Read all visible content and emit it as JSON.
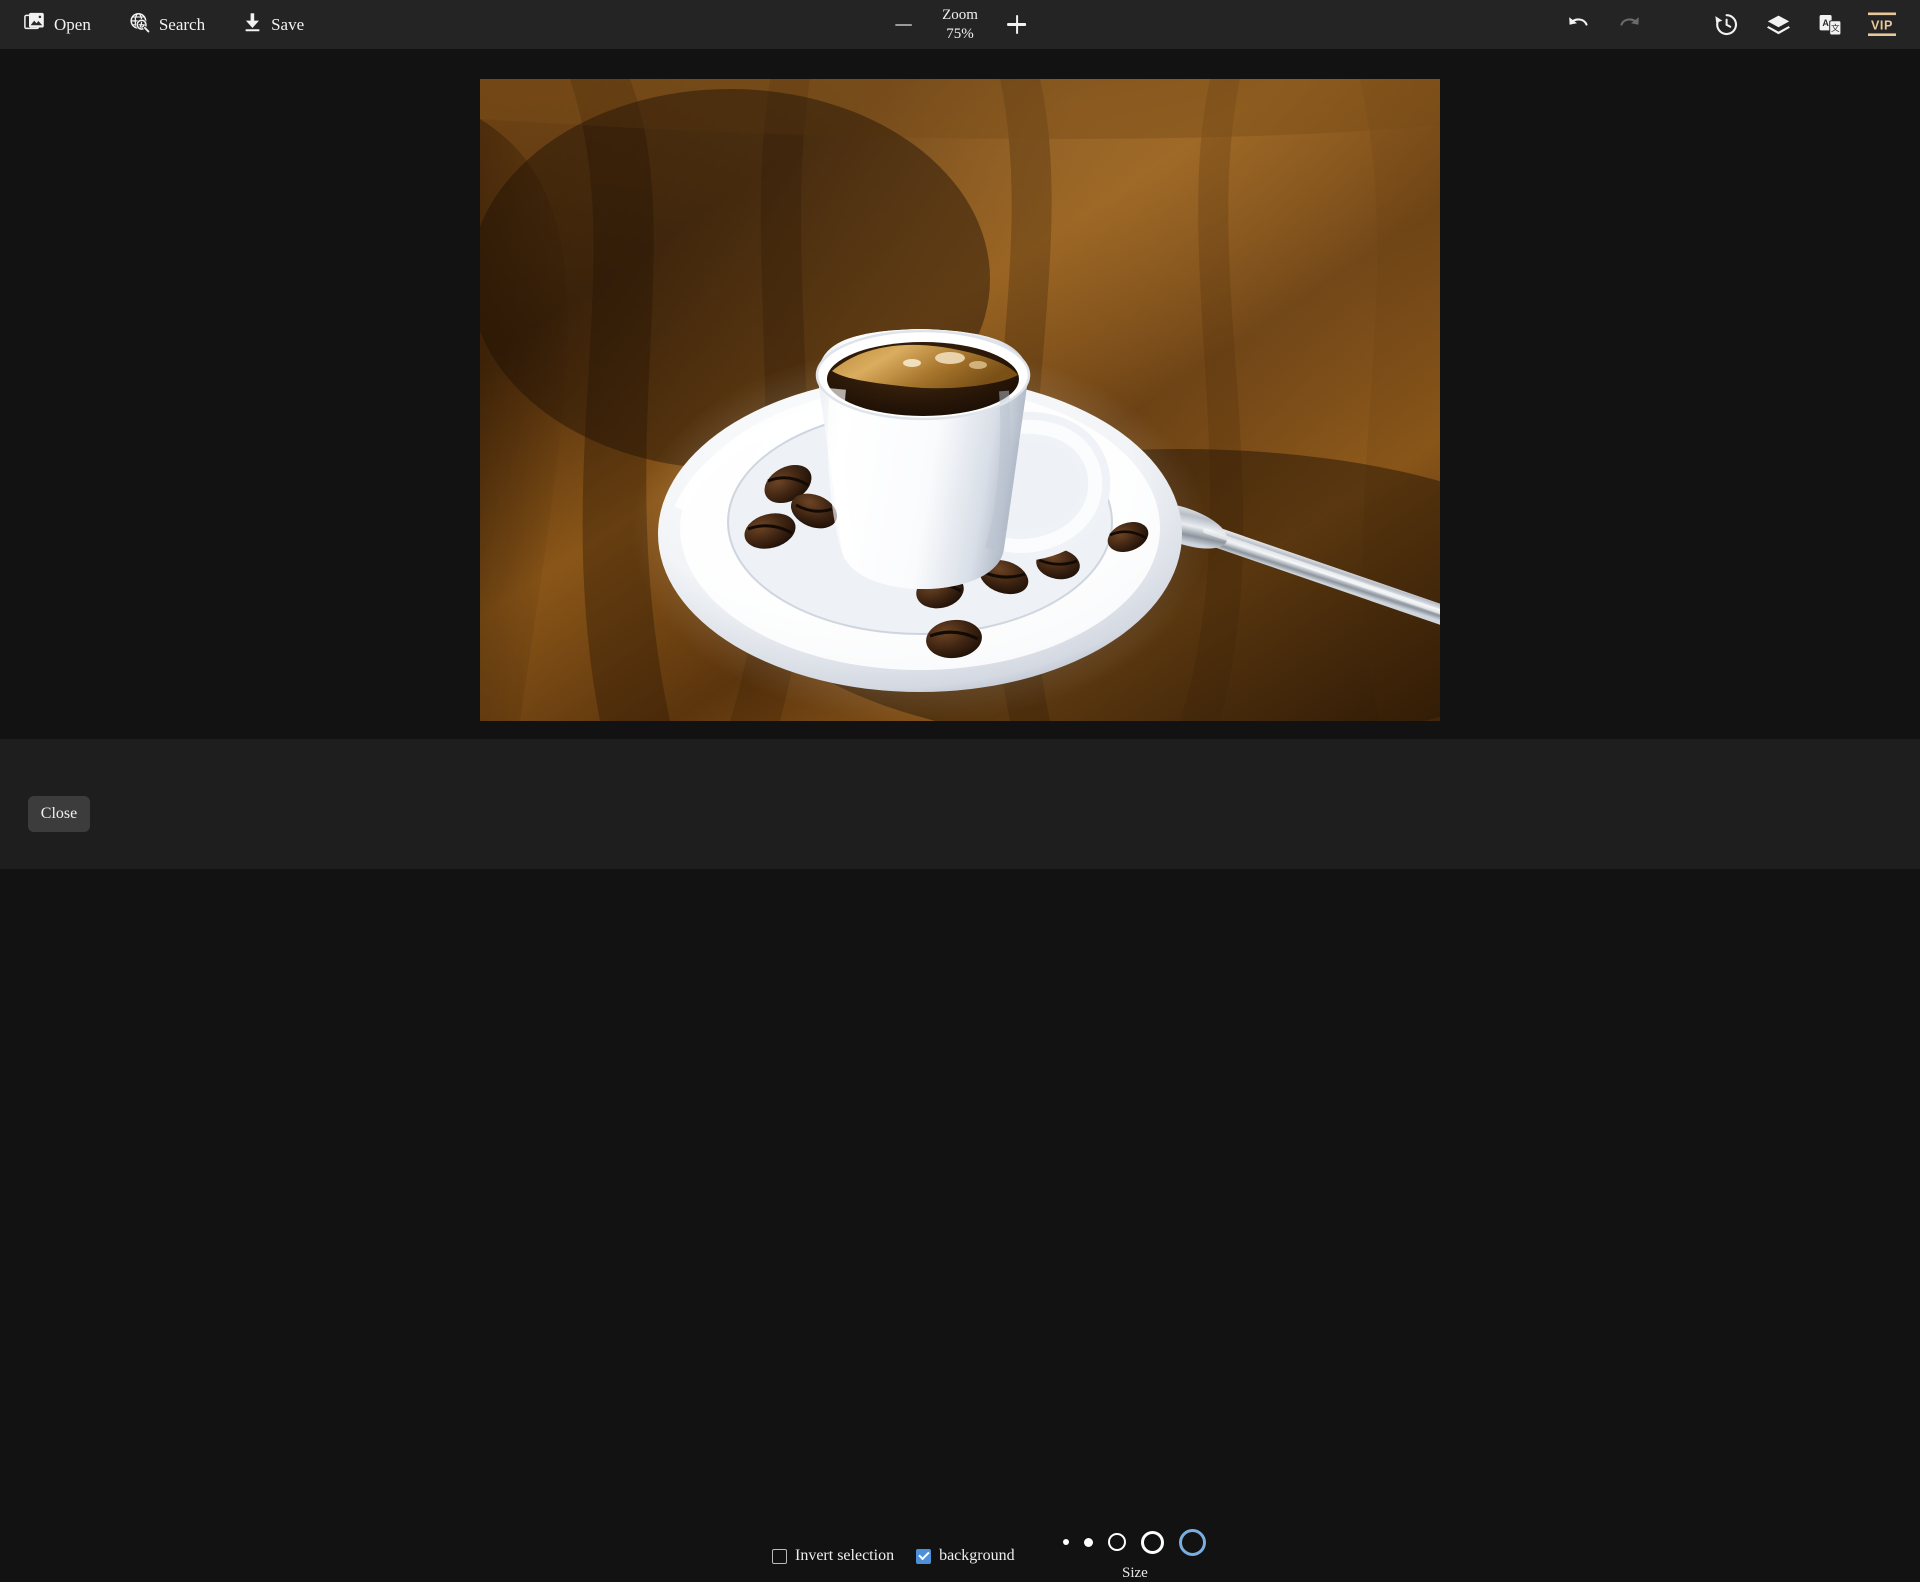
{
  "toolbar": {
    "left_items": [
      {
        "label": "Open",
        "icon": "image-stack-icon"
      },
      {
        "label": "Search",
        "icon": "globe-search-icon"
      },
      {
        "label": "Save",
        "icon": "download-icon"
      }
    ],
    "zoom": {
      "title": "Zoom",
      "value": "75%",
      "minus_label": "−",
      "plus_label": "+"
    },
    "right_items": [
      {
        "name": "undo-icon",
        "state": "enabled"
      },
      {
        "name": "redo-icon",
        "state": "disabled"
      },
      {
        "name": "history-icon",
        "state": "enabled"
      },
      {
        "name": "layers-icon",
        "state": "enabled"
      },
      {
        "name": "translate-icon",
        "state": "enabled"
      },
      {
        "name": "vip-badge",
        "state": "enabled",
        "label": "VIP"
      }
    ]
  },
  "canvas": {
    "image_alt": "Espresso cup with coffee beans and spoon on a wooden table"
  },
  "footer": {
    "close_label": "Close",
    "options": [
      {
        "label": "Invert selection",
        "checked": false
      },
      {
        "label": "background",
        "checked": true
      }
    ],
    "size": {
      "label": "Size",
      "options": [
        1,
        2,
        3,
        4,
        5
      ],
      "selected": 5
    }
  },
  "colors": {
    "toolbar_bg": "#242424",
    "canvas_bg": "#121212",
    "footer_bg": "#1e1e1e",
    "accent_blue": "#4e90d8",
    "size_selected": "#7aaee0",
    "vip_gold": "#e8c89a",
    "text": "#f2f2f2"
  }
}
